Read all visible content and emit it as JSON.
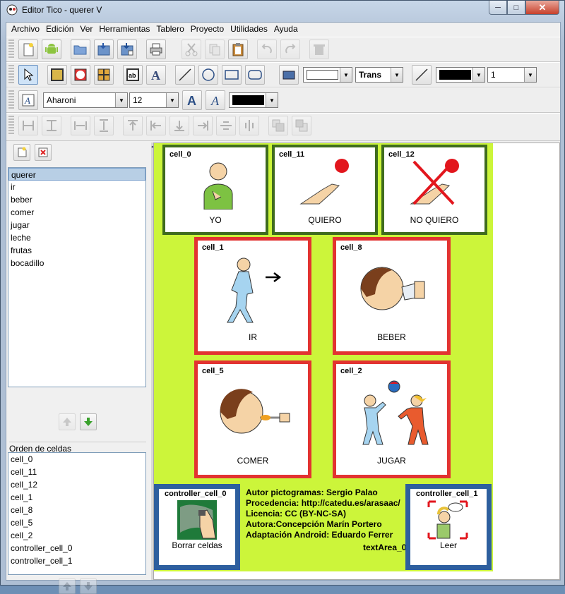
{
  "window": {
    "title": "Editor Tico - querer V"
  },
  "menu": [
    "Archivo",
    "Edición",
    "Ver",
    "Herramientas",
    "Tablero",
    "Proyecto",
    "Utilidades",
    "Ayuda"
  ],
  "toolbar": {
    "font_name": "Aharoni",
    "font_size": "12",
    "fill_mode": "Trans",
    "line_width": "1",
    "text_color": "#000000",
    "line_color": "#000000",
    "fill_color": "#ffffff"
  },
  "boards": {
    "items": [
      "querer",
      "ir",
      "beber",
      "comer",
      "jugar",
      "leche",
      "frutas",
      "bocadillo"
    ],
    "selected": "querer"
  },
  "cell_order": {
    "title": "Orden de celdas",
    "items": [
      "cell_0",
      "cell_11",
      "cell_12",
      "cell_1",
      "cell_8",
      "cell_5",
      "cell_2",
      "controller_cell_0",
      "controller_cell_1"
    ]
  },
  "board": {
    "background": "#ccf53a",
    "cells": [
      {
        "name": "cell_0",
        "label": "YO",
        "pictogram": "person-pointing-self",
        "border": "#3f6c1e"
      },
      {
        "name": "cell_11",
        "label": "QUIERO",
        "pictogram": "hand-reaching-red-ball",
        "border": "#3f6c1e"
      },
      {
        "name": "cell_12",
        "label": "NO QUIERO",
        "pictogram": "hand-crossed-out",
        "border": "#3f6c1e"
      },
      {
        "name": "cell_1",
        "label": "IR",
        "pictogram": "person-walking",
        "border": "#e23331"
      },
      {
        "name": "cell_8",
        "label": "BEBER",
        "pictogram": "person-drinking",
        "border": "#e23331"
      },
      {
        "name": "cell_5",
        "label": "COMER",
        "pictogram": "person-eating",
        "border": "#e23331"
      },
      {
        "name": "cell_2",
        "label": "JUGAR",
        "pictogram": "children-playing-ball",
        "border": "#e23331"
      },
      {
        "name": "controller_cell_0",
        "label": "Borrar celdas",
        "pictogram": "hand-erasing",
        "border": "#2d5f9e"
      },
      {
        "name": "controller_cell_1",
        "label": "Leer",
        "pictogram": "person-speaking",
        "border": "#2d5f9e"
      }
    ],
    "info_lines": [
      "Autor pictogramas: Sergio Palao",
      "Procedencia: http://catedu.es/arasaac/",
      "Licencia: CC (BY-NC-SA)",
      "Autora:Concepción Marín Portero",
      "Adaptación Android: Eduardo Ferrer"
    ],
    "textarea_label": "textArea_0"
  }
}
